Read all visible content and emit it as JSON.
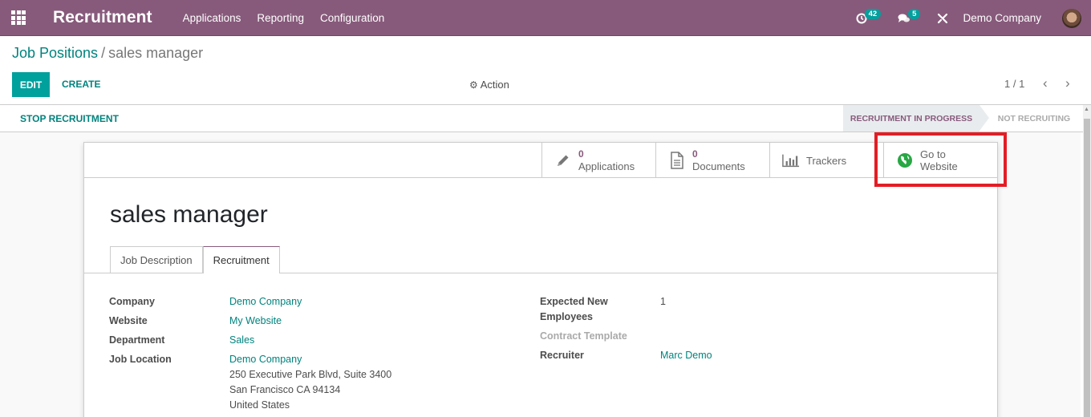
{
  "navbar": {
    "app_title": "Recruitment",
    "menu": [
      "Applications",
      "Reporting",
      "Configuration"
    ],
    "activity_count": "42",
    "message_count": "5",
    "company": "Demo Company",
    "bg_color": "#875a7b"
  },
  "breadcrumb": {
    "parent": "Job Positions",
    "separator": "/",
    "current": "sales manager"
  },
  "control_panel": {
    "edit_label": "EDIT",
    "create_label": "CREATE",
    "action_label": "Action",
    "pager": "1 / 1"
  },
  "statusbar": {
    "stop_label": "STOP RECRUITMENT",
    "stages": [
      {
        "label": "RECRUITMENT IN PROGRESS",
        "active": true
      },
      {
        "label": "NOT RECRUITING",
        "active": false
      }
    ]
  },
  "smart_buttons": [
    {
      "icon": "pencil-icon",
      "count": "0",
      "label": "Applications"
    },
    {
      "icon": "document-icon",
      "count": "0",
      "label": "Documents"
    },
    {
      "icon": "bar-chart-icon",
      "label": "Trackers"
    },
    {
      "icon": "globe-icon",
      "line1": "Go to",
      "line2": "Website"
    }
  ],
  "form": {
    "title": "sales manager",
    "tabs": [
      {
        "label": "Job Description",
        "active": false
      },
      {
        "label": "Recruitment",
        "active": true
      }
    ],
    "left_fields": {
      "company_label": "Company",
      "company_value": "Demo Company",
      "website_label": "Website",
      "website_value": "My Website",
      "department_label": "Department",
      "department_value": "Sales",
      "location_label": "Job Location",
      "location_name": "Demo Company",
      "location_street": "250 Executive Park Blvd, Suite 3400",
      "location_city": "San Francisco CA 94134",
      "location_country": "United States"
    },
    "right_fields": {
      "expected_label_1": "Expected New",
      "expected_label_2": "Employees",
      "expected_value": "1",
      "contract_label": "Contract Template",
      "recruiter_label": "Recruiter",
      "recruiter_value": "Marc Demo"
    }
  },
  "colors": {
    "primary": "#00a09d",
    "link": "#00837e",
    "accent": "#875a7b",
    "highlight_box": "#e31d25"
  }
}
